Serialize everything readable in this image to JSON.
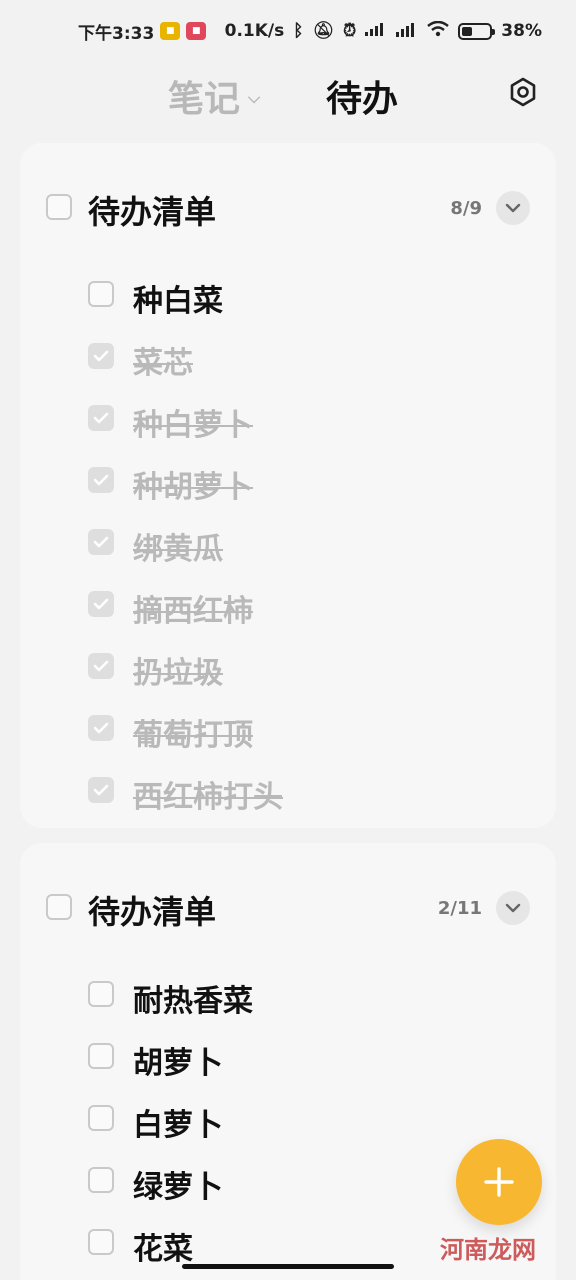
{
  "status_bar": {
    "time": "下午3:33",
    "app_badges": [
      {
        "name": "app-badge-1",
        "color": "#e8b400"
      },
      {
        "name": "app-badge-2",
        "color": "#e0475a"
      }
    ],
    "network_speed": "0.1K/s",
    "battery": "38%",
    "battery_level": 0.38
  },
  "header": {
    "tab_notes": "笔记",
    "tab_todo": "待办"
  },
  "lists": [
    {
      "title": "待办清单",
      "count": "8/9",
      "items": [
        {
          "text": "种白菜",
          "done": false
        },
        {
          "text": "菜芯",
          "done": true
        },
        {
          "text": "种白萝卜",
          "done": true
        },
        {
          "text": "种胡萝卜",
          "done": true
        },
        {
          "text": "绑黄瓜",
          "done": true
        },
        {
          "text": "摘西红柿",
          "done": true
        },
        {
          "text": "扔垃圾",
          "done": true
        },
        {
          "text": "葡萄打顶",
          "done": true
        },
        {
          "text": "西红柿打头",
          "done": true
        }
      ]
    },
    {
      "title": "待办清单",
      "count": "2/11",
      "items": [
        {
          "text": "耐热香菜",
          "done": false
        },
        {
          "text": "胡萝卜",
          "done": false
        },
        {
          "text": "白萝卜",
          "done": false
        },
        {
          "text": "绿萝卜",
          "done": false
        },
        {
          "text": "花菜",
          "done": false
        }
      ]
    }
  ],
  "fab": {
    "icon": "plus-icon",
    "color": "#f7b731"
  },
  "watermark": "河南龙网"
}
